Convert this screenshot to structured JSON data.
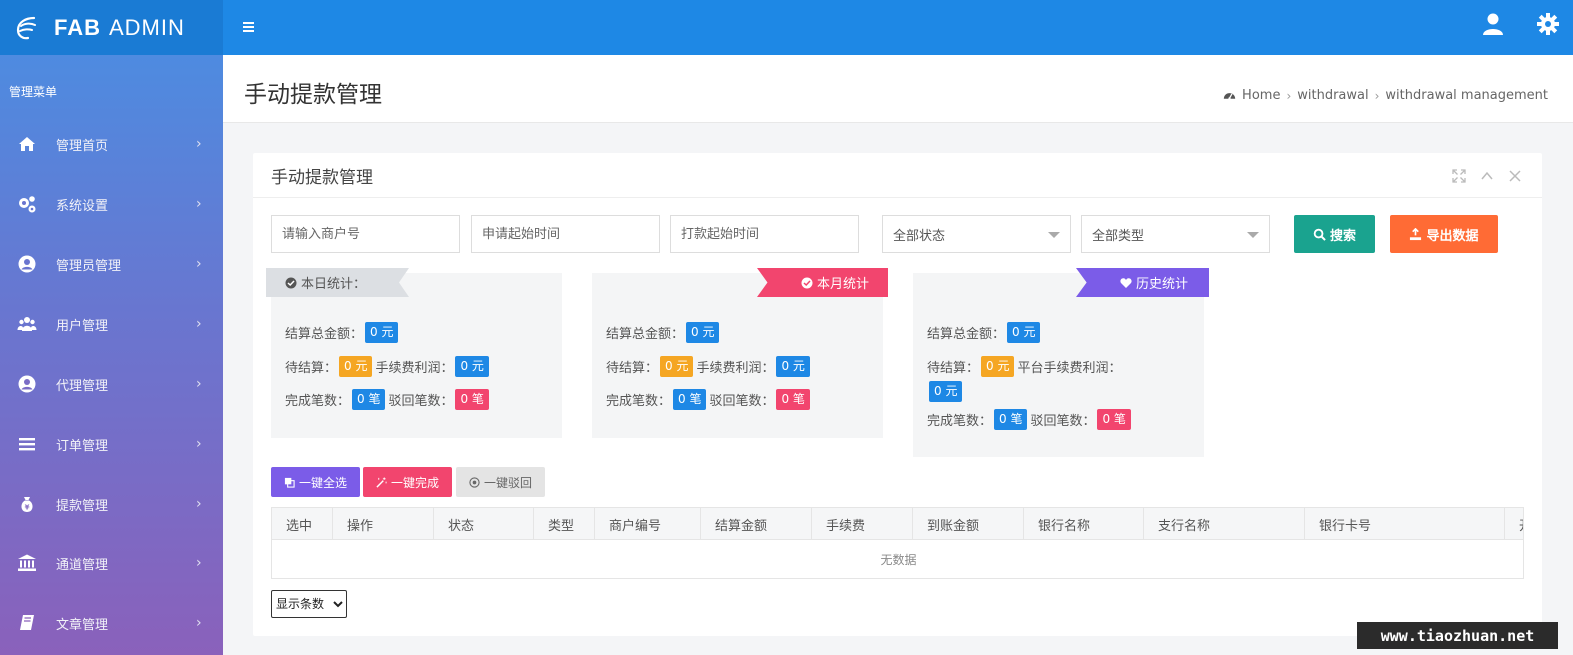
{
  "brand": {
    "name_bold": "FAB",
    "name_rest": "ADMIN"
  },
  "header": {
    "user_icon": "user-icon",
    "settings_icon": "gear-icon"
  },
  "sidebar": {
    "title": "管理菜单",
    "items": [
      {
        "label": "管理首页",
        "icon": "home-icon"
      },
      {
        "label": "系统设置",
        "icon": "gears-icon"
      },
      {
        "label": "管理员管理",
        "icon": "user-circle-icon"
      },
      {
        "label": "用户管理",
        "icon": "users-icon"
      },
      {
        "label": "代理管理",
        "icon": "user-circle-icon"
      },
      {
        "label": "订单管理",
        "icon": "list-icon"
      },
      {
        "label": "提款管理",
        "icon": "money-bag-icon"
      },
      {
        "label": "通道管理",
        "icon": "bank-icon"
      },
      {
        "label": "文章管理",
        "icon": "book-icon"
      }
    ]
  },
  "page": {
    "title": "手动提款管理",
    "breadcrumb": [
      "Home",
      "withdrawal",
      "withdrawal management"
    ]
  },
  "panel": {
    "title": "手动提款管理"
  },
  "filters": {
    "merchant_placeholder": "请输入商户号",
    "apply_time_placeholder": "申请起始时间",
    "pay_time_placeholder": "打款起始时间",
    "status_value": "全部状态",
    "type_value": "全部类型",
    "search_label": "搜索",
    "export_label": "导出数据"
  },
  "stats": {
    "today": {
      "ribbon": "本日统计：",
      "total_label": "结算总金额：",
      "total_value": "0 元",
      "pending_label": "待结算：",
      "pending_value": "0 元",
      "fee_label": "手续费利润：",
      "fee_value": "0 元",
      "done_label": "完成笔数：",
      "done_value": "0 笔",
      "reject_label": "驳回笔数：",
      "reject_value": "0 笔"
    },
    "month": {
      "ribbon": "本月统计",
      "total_label": "结算总金额：",
      "total_value": "0 元",
      "pending_label": "待结算：",
      "pending_value": "0 元",
      "fee_label": "手续费利润：",
      "fee_value": "0 元",
      "done_label": "完成笔数：",
      "done_value": "0 笔",
      "reject_label": "驳回笔数：",
      "reject_value": "0 笔"
    },
    "history": {
      "ribbon": "历史统计",
      "total_label": "结算总金额：",
      "total_value": "0 元",
      "pending_label": "待结算：",
      "pending_value": "0 元",
      "fee_label": "平台手续费利润：",
      "fee_value": "0 元",
      "done_label": "完成笔数：",
      "done_value": "0 笔",
      "reject_label": "驳回笔数：",
      "reject_value": "0 笔"
    }
  },
  "actions": {
    "select_all": "一键全选",
    "complete_all": "一键完成",
    "reject_all": "一键驳回"
  },
  "table": {
    "columns": [
      "选中",
      "操作",
      "状态",
      "类型",
      "商户编号",
      "结算金额",
      "手续费",
      "到账金额",
      "银行名称",
      "支行名称",
      "银行卡号",
      "开"
    ],
    "empty_text": "无数据"
  },
  "pager": {
    "page_size_label": "显示条数"
  },
  "watermark": "www.tiaozhuan.net",
  "colors": {
    "topbar": "#1e88e5",
    "search": "#1aa38f",
    "export": "#ff6b35",
    "purple": "#7b5ce8",
    "pink": "#f2456e",
    "blue_badge": "#1e88e5",
    "orange_badge": "#f5a623"
  }
}
